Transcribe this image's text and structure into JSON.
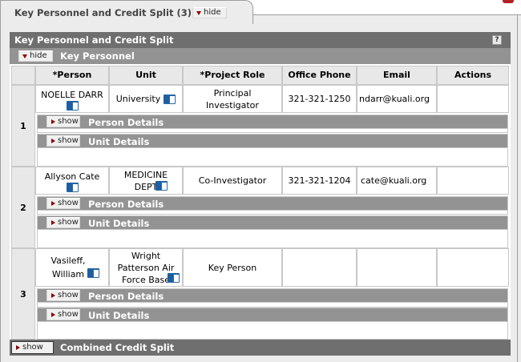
{
  "tab": {
    "title": "Key Personnel and Credit Split (3)",
    "hide_label": "hide"
  },
  "section": {
    "title": "Key Personnel and Credit Split",
    "help_icon": "?"
  },
  "subsection": {
    "toggle_label": "hide",
    "title": "Key Personnel"
  },
  "table": {
    "headers": [
      "*Person",
      "Unit",
      "*Project Role",
      "Office Phone",
      "Email",
      "Actions"
    ],
    "rows": [
      {
        "num": "1",
        "person": "NOELLE DARR",
        "unit": "University",
        "role": "Principal Investigator",
        "phone": "321-321-1250",
        "email": "ndarr@kuali.org",
        "actions": ""
      },
      {
        "num": "2",
        "person": "Allyson Cate",
        "unit": "MEDICINE DEPT",
        "role": "Co-Investigator",
        "phone": "321-321-1204",
        "email": "cate@kuali.org",
        "actions": ""
      },
      {
        "num": "3",
        "person": "Vasileff, William",
        "unit": "Wright Patterson Air Force Base",
        "role": "Key Person",
        "phone": "",
        "email": "",
        "actions": ""
      }
    ],
    "detail_show_label": "show",
    "person_details_title": "Person Details",
    "unit_details_title": "Unit Details"
  },
  "footer": {
    "toggle_label": "show",
    "title": "Combined Credit Split"
  },
  "colors": {
    "dark_bar": "#6f6f6f",
    "mid_bar": "#939393",
    "header_bg": "#e8e8e8",
    "accent_triangle": "#8b0000",
    "book_icon": "#1d5fa0"
  }
}
